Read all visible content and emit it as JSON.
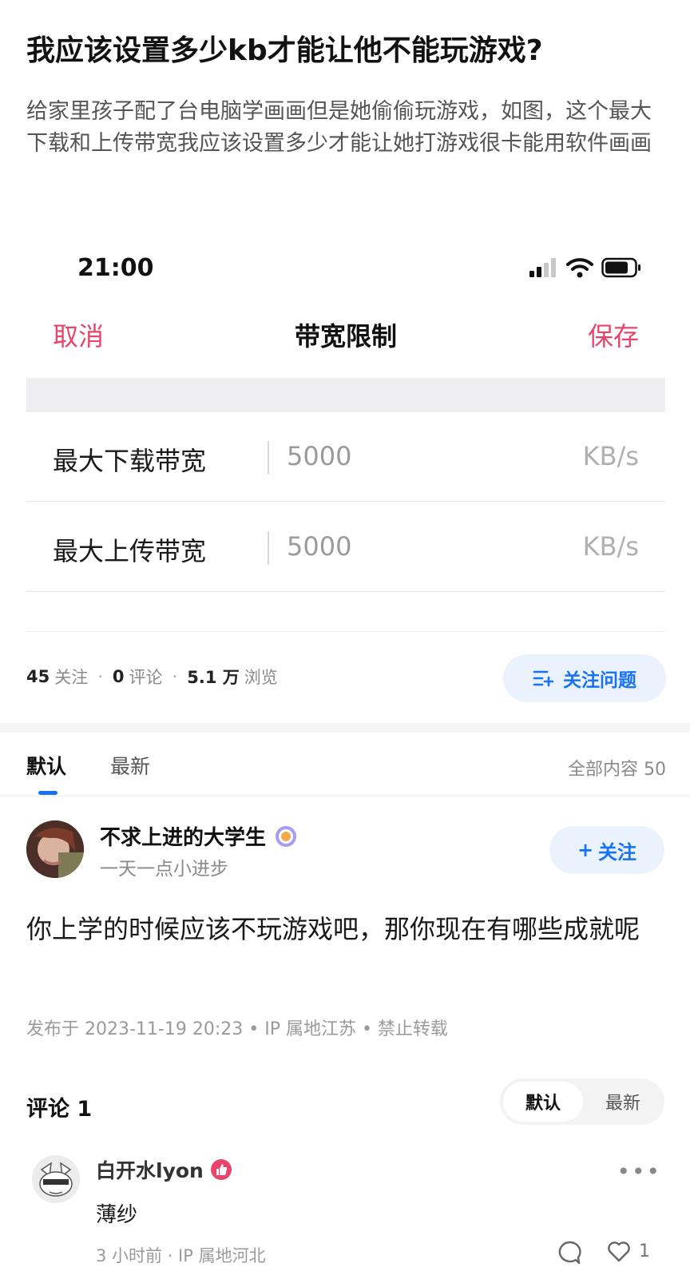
{
  "question": {
    "title": "我应该设置多少kb才能让他不能玩游戏?",
    "description": "给家里孩子配了台电脑学画画但是她偷偷玩游戏，如图，这个最大下载和上传带宽我应该设置多少才能让她打游戏很卡能用软件画画"
  },
  "screenshot": {
    "status_time": "21:00",
    "nav": {
      "cancel": "取消",
      "title": "带宽限制",
      "save": "保存"
    },
    "rows": [
      {
        "label": "最大下载带宽",
        "value": "5000",
        "unit": "KB/s"
      },
      {
        "label": "最大上传带宽",
        "value": "5000",
        "unit": "KB/s"
      }
    ]
  },
  "stats": {
    "followers_count": "45",
    "followers_label": "关注",
    "comments_count": "0",
    "comments_label": "评论",
    "views_count": "5.1 万",
    "views_label": "浏览",
    "follow_question_label": "关注问题"
  },
  "answer_tabs": {
    "default": "默认",
    "newest": "最新",
    "all_content": "全部内容 50"
  },
  "answer": {
    "author_name": "不求上进的大学生",
    "author_bio": "一天一点小进步",
    "follow_label": "关注",
    "body": "你上学的时候应该不玩游戏吧，那你现在有哪些成就呢",
    "meta": "发布于 2023-11-19 20:23 • IP 属地江苏 • 禁止转载"
  },
  "comments": {
    "title": "评论 1",
    "sort_default": "默认",
    "sort_newest": "最新",
    "items": [
      {
        "name": "白开水lyon",
        "text": "薄纱",
        "meta": "3 小时前 · IP 属地河北",
        "likes": "1"
      }
    ]
  },
  "colors": {
    "accent_blue": "#1772f6",
    "accent_pink": "#e8446c"
  }
}
